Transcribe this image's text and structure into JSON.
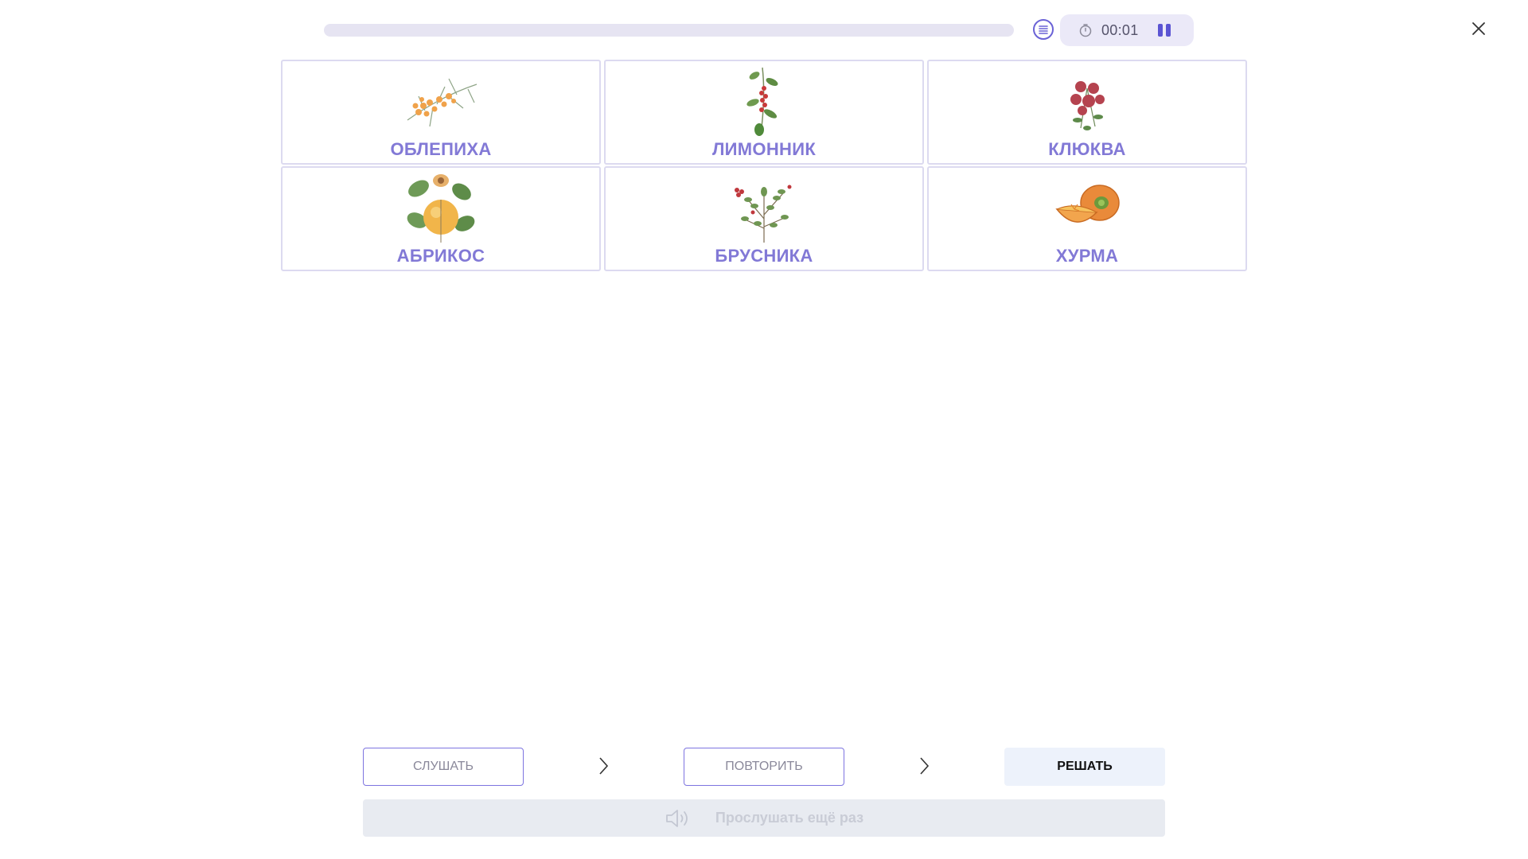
{
  "header": {
    "progress_fraction": 0.0,
    "timer": "00:01",
    "icons": {
      "list": "list-circle-icon",
      "timer": "stopwatch-icon",
      "pause": "pause-icon",
      "close": "close-icon"
    }
  },
  "cards": [
    {
      "label": "ОБЛЕПИХА",
      "icon": "sea-buckthorn-image"
    },
    {
      "label": "ЛИМОННИК",
      "icon": "schisandra-image"
    },
    {
      "label": "КЛЮКВА",
      "icon": "cranberry-image"
    },
    {
      "label": "АБРИКОС",
      "icon": "apricot-image"
    },
    {
      "label": "БРУСНИКА",
      "icon": "lingonberry-image"
    },
    {
      "label": "ХУРМА",
      "icon": "persimmon-image"
    }
  ],
  "steps": {
    "listen": "СЛУШАТЬ",
    "repeat": "ПОВТОРИТЬ",
    "solve": "РЕШАТЬ"
  },
  "replay": {
    "label": "Прослушать ещё раз",
    "icon": "speaker-icon"
  },
  "colors": {
    "accent": "#7d74e0",
    "card_label": "#8279d6",
    "card_border": "#dcdaf0"
  }
}
